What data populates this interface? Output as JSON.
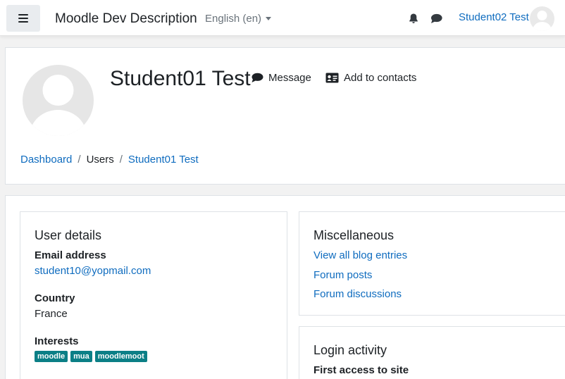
{
  "navbar": {
    "site_name": "Moodle Dev Description",
    "language": "English (en)",
    "user_name": "Student02 Test"
  },
  "icons": {
    "menu": "hamburger-icon",
    "notifications": "bell-icon",
    "messages": "chat-icon",
    "avatar": "user-avatar-icon"
  },
  "profile": {
    "name": "Student01 Test",
    "message_label": "Message",
    "add_contact_label": "Add to contacts"
  },
  "breadcrumb": [
    "Dashboard",
    "Users",
    "Student01 Test"
  ],
  "user_details": {
    "title": "User details",
    "email_label": "Email address",
    "email": "student10@yopmail.com",
    "country_label": "Country",
    "country": "France",
    "interests_label": "Interests",
    "interests": [
      "moodle",
      "mua",
      "moodlemoot"
    ]
  },
  "misc": {
    "title": "Miscellaneous",
    "links": [
      "View all blog entries",
      "Forum posts",
      "Forum discussions"
    ]
  },
  "login": {
    "title": "Login activity",
    "first_access_label": "First access to site"
  },
  "colors": {
    "link": "#0f6cbf",
    "tag": "#0b7f86",
    "page_bg": "#f2f2f2"
  }
}
